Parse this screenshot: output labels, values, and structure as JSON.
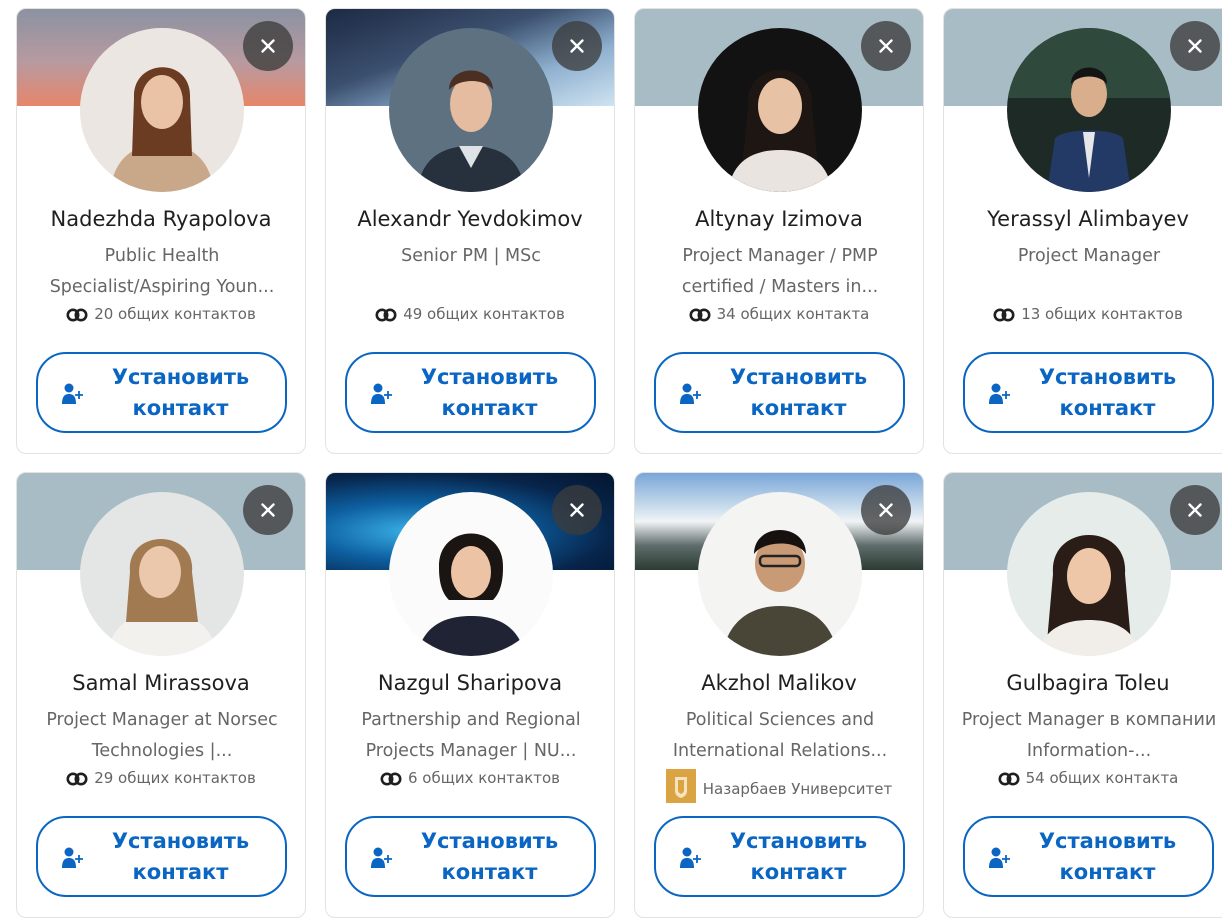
{
  "connect_label": "Установить контакт",
  "colors": {
    "accent": "#0a66c2",
    "text_primary": "#1f1f1f",
    "text_secondary": "#666666",
    "close_bg": "#3c3c3c"
  },
  "icons": {
    "dismiss": "close-icon",
    "mutual": "mutual-connections-icon",
    "connect": "person-add-icon",
    "school": "university-logo"
  },
  "cards": [
    {
      "name": "Nadezhda Ryapolova",
      "headline": "Public Health Specialist/Aspiring Youn...",
      "mutual": "20 общих контактов"
    },
    {
      "name": "Alexandr Yevdokimov",
      "headline": "Senior PM | MSc",
      "mutual": "49 общих контактов"
    },
    {
      "name": "Altynay Izimova",
      "headline": "Project Manager / PMP certified / Masters in...",
      "mutual": "34 общих контакта"
    },
    {
      "name": "Yerassyl Alimbayev",
      "headline": "Project Manager",
      "mutual": "13 общих контактов"
    },
    {
      "name": "Samal Mirassova",
      "headline": "Project Manager at Norsec Technologies |...",
      "mutual": "29 общих контактов"
    },
    {
      "name": "Nazgul Sharipova",
      "headline": "Partnership and Regional Projects Manager | NU...",
      "mutual": "6 общих контактов"
    },
    {
      "name": "Akzhol Malikov",
      "headline": "Political Sciences and International Relations...",
      "mutual": "Назарбаев Университет"
    },
    {
      "name": "Gulbagira Toleu",
      "headline": "Project Manager в компании Information-...",
      "mutual": "54 общих контакта"
    }
  ]
}
